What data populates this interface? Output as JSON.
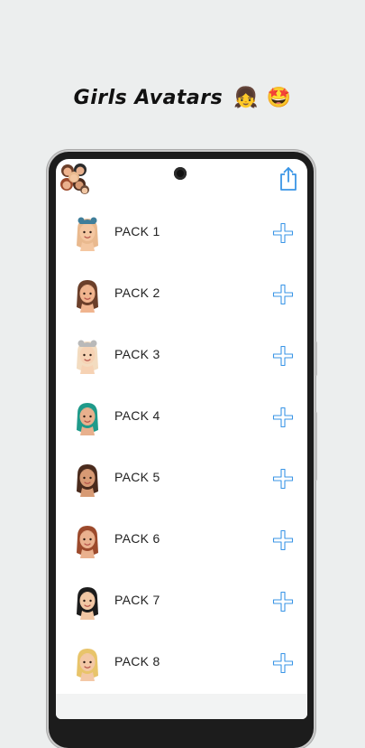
{
  "promo": {
    "title": "Girls Avatars",
    "emoji": "👧 🤩"
  },
  "toolbar": {
    "logo_icon": "avatar-collage-icon",
    "share_icon": "share-icon"
  },
  "colors": {
    "accent": "#3a95e6",
    "background": "#eceeee",
    "screen": "#ffffff"
  },
  "packs": [
    {
      "label": "PACK 1",
      "hair": "#e9b98e",
      "skin": "#f4c7a1",
      "hat": "#3f7e9a"
    },
    {
      "label": "PACK 2",
      "hair": "#6b3f2a",
      "skin": "#f0b48e",
      "hat": ""
    },
    {
      "label": "PACK 3",
      "hair": "#f3dcc0",
      "skin": "#f6d2b4",
      "hat": "#b9b9b9"
    },
    {
      "label": "PACK 4",
      "hair": "#1f9a8a",
      "skin": "#e8b08d",
      "hat": ""
    },
    {
      "label": "PACK 5",
      "hair": "#4a2b1d",
      "skin": "#d79a74",
      "hat": ""
    },
    {
      "label": "PACK 6",
      "hair": "#9c4a2c",
      "skin": "#eab18e",
      "hat": ""
    },
    {
      "label": "PACK 7",
      "hair": "#1c1c1c",
      "skin": "#f1c7a4",
      "hat": ""
    },
    {
      "label": "PACK 8",
      "hair": "#e8c46a",
      "skin": "#f3c8a6",
      "hat": ""
    }
  ]
}
